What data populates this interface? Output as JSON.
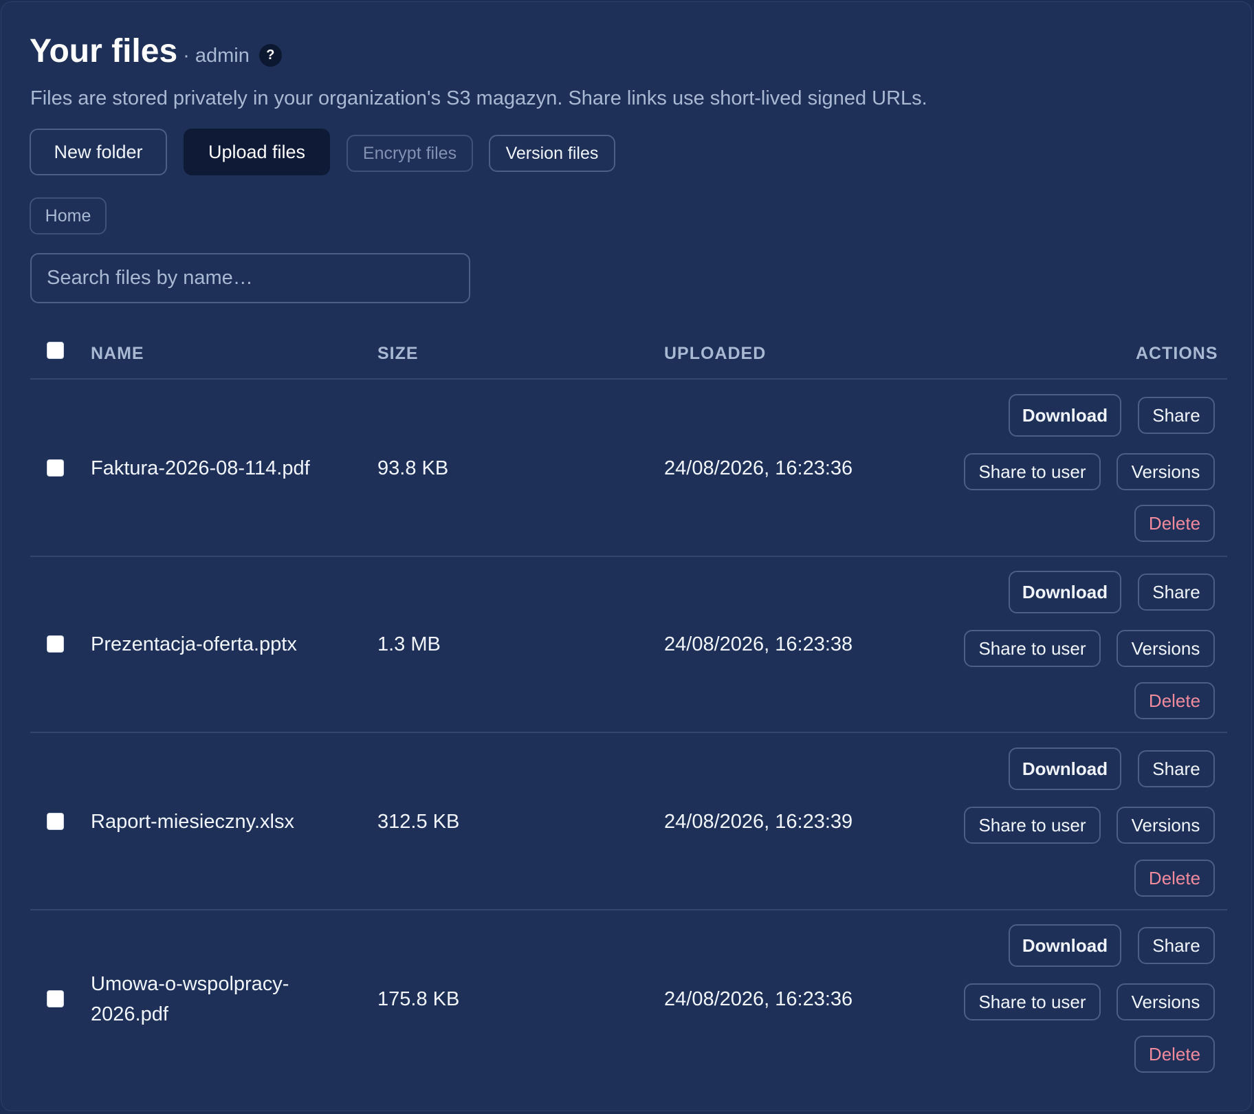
{
  "header": {
    "title": "Your files",
    "owner": "· admin",
    "help_icon": "?",
    "subtitle": "Files are stored privately in your organization's S3 magazyn. Share links use short-lived signed URLs."
  },
  "toolbar": {
    "new_folder": "New folder",
    "upload_files": "Upload files",
    "encrypt_files": "Encrypt files",
    "version_files": "Version files"
  },
  "breadcrumb": {
    "home": "Home"
  },
  "search": {
    "placeholder": "Search files by name…",
    "value": ""
  },
  "table": {
    "columns": {
      "name": "NAME",
      "size": "SIZE",
      "uploaded": "UPLOADED",
      "actions": "ACTIONS"
    },
    "actions": {
      "download": "Download",
      "share": "Share",
      "share_to_user": "Share to user",
      "versions": "Versions",
      "delete": "Delete"
    },
    "rows": [
      {
        "name": "Faktura-2026-08-114.pdf",
        "size": "93.8 KB",
        "uploaded": "24/08/2026, 16:23:36"
      },
      {
        "name": "Prezentacja-oferta.pptx",
        "size": "1.3 MB",
        "uploaded": "24/08/2026, 16:23:38"
      },
      {
        "name": "Raport-miesieczny.xlsx",
        "size": "312.5 KB",
        "uploaded": "24/08/2026, 16:23:39"
      },
      {
        "name": "Umowa-o-wspolpracy-2026.pdf",
        "size": "175.8 KB",
        "uploaded": "24/08/2026, 16:23:36"
      }
    ]
  },
  "colors": {
    "background": "#1e3058",
    "primary_button": "#0e1a36",
    "danger_text": "#f08a9d",
    "muted_text": "#a9b8d3"
  }
}
